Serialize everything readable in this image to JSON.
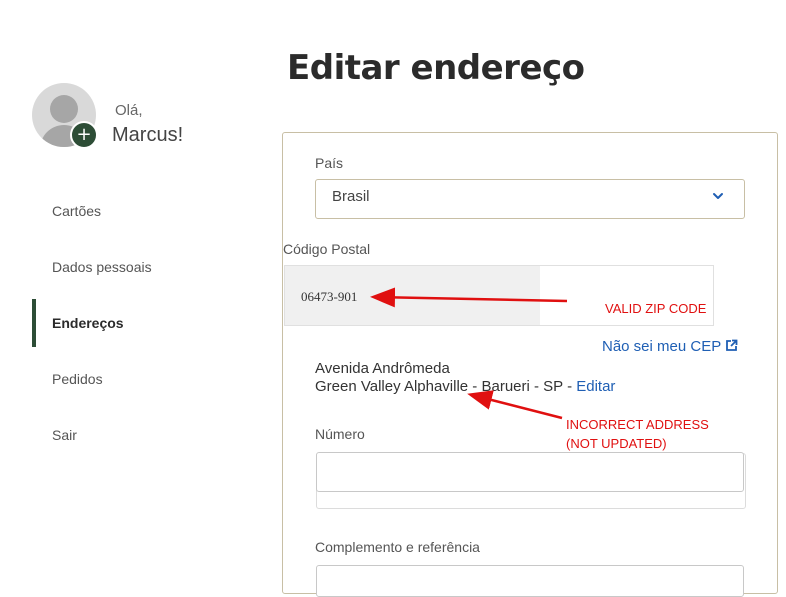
{
  "user": {
    "greeting": "Olá,",
    "name": "Marcus!"
  },
  "sidebar": {
    "items": [
      {
        "label": "Cartões",
        "active": false
      },
      {
        "label": "Dados pessoais",
        "active": false
      },
      {
        "label": "Endereços",
        "active": true
      },
      {
        "label": "Pedidos",
        "active": false
      },
      {
        "label": "Sair",
        "active": false
      }
    ]
  },
  "page": {
    "title": "Editar endereço"
  },
  "form": {
    "country_label": "País",
    "country_value": "Brasil",
    "zip_label": "Código Postal",
    "zip_value": "06473-901",
    "zip_help_link": "Não sei meu CEP",
    "address_line1": "Avenida Andrômeda",
    "address_line2": "Green Valley Alphaville - Barueri - SP - ",
    "address_edit_link": "Editar",
    "number_label": "Número",
    "number_value": "",
    "complement_label": "Complemento e referência",
    "complement_value": ""
  },
  "annotations": {
    "zip": "VALID ZIP CODE",
    "address_line1": "INCORRECT ADDRESS",
    "address_line2": "(NOT UPDATED)",
    "color": "#e01010"
  },
  "colors": {
    "accent_green": "#2d4d36",
    "link_blue": "#1f5fb4",
    "border_beige": "#c8bfa5"
  }
}
